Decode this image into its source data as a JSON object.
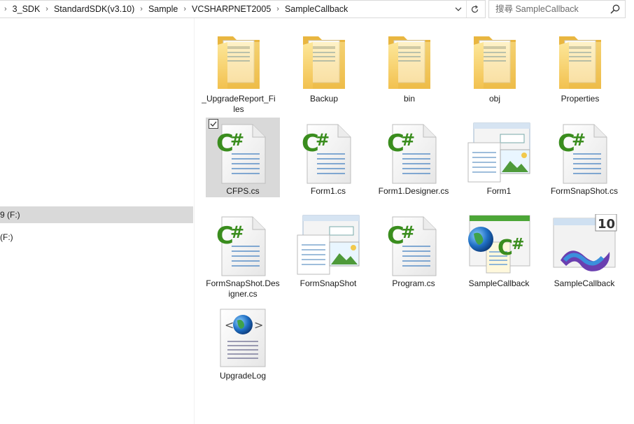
{
  "breadcrumb": [
    "3_SDK",
    "StandardSDK(v3.10)",
    "Sample",
    "VCSHARPNET2005",
    "SampleCallback"
  ],
  "address_icons": {
    "dropdown": "chevron-down-icon",
    "refresh": "refresh-icon"
  },
  "search": {
    "placeholder": "搜尋 SampleCallback",
    "icon": "search-icon"
  },
  "nav": {
    "items": [
      {
        "label": "9 (F:)",
        "selected": true
      },
      {
        "label": "(F:)",
        "selected": false
      }
    ]
  },
  "files": [
    {
      "label": "_UpgradeReport_Files",
      "icon": "folder-icon",
      "selected": false
    },
    {
      "label": "Backup",
      "icon": "folder-icon",
      "selected": false
    },
    {
      "label": "bin",
      "icon": "folder-icon",
      "selected": false
    },
    {
      "label": "obj",
      "icon": "folder-icon",
      "selected": false
    },
    {
      "label": "Properties",
      "icon": "folder-icon",
      "selected": false
    },
    {
      "label": "CFPS.cs",
      "icon": "csharp-file-icon",
      "selected": true
    },
    {
      "label": "Form1.cs",
      "icon": "csharp-file-icon",
      "selected": false
    },
    {
      "label": "Form1.Designer.cs",
      "icon": "csharp-file-icon",
      "selected": false
    },
    {
      "label": "Form1",
      "icon": "resx-file-icon",
      "selected": false
    },
    {
      "label": "FormSnapShot.cs",
      "icon": "csharp-file-icon",
      "selected": false
    },
    {
      "label": "FormSnapShot.Designer.cs",
      "icon": "csharp-file-icon",
      "selected": false
    },
    {
      "label": "FormSnapShot",
      "icon": "resx-file-icon",
      "selected": false
    },
    {
      "label": "Program.cs",
      "icon": "csharp-file-icon",
      "selected": false
    },
    {
      "label": "SampleCallback",
      "icon": "csproj-file-icon",
      "selected": false
    },
    {
      "label": "SampleCallback",
      "icon": "vs-solution-icon",
      "selected": false
    },
    {
      "label": "UpgradeLog",
      "icon": "xml-log-icon",
      "selected": false
    }
  ],
  "colors": {
    "selection": "#d9d9d9",
    "folder": "#f5c85a",
    "csharp": "#3a8d1e",
    "doc_lines": "#5b8fc7"
  }
}
